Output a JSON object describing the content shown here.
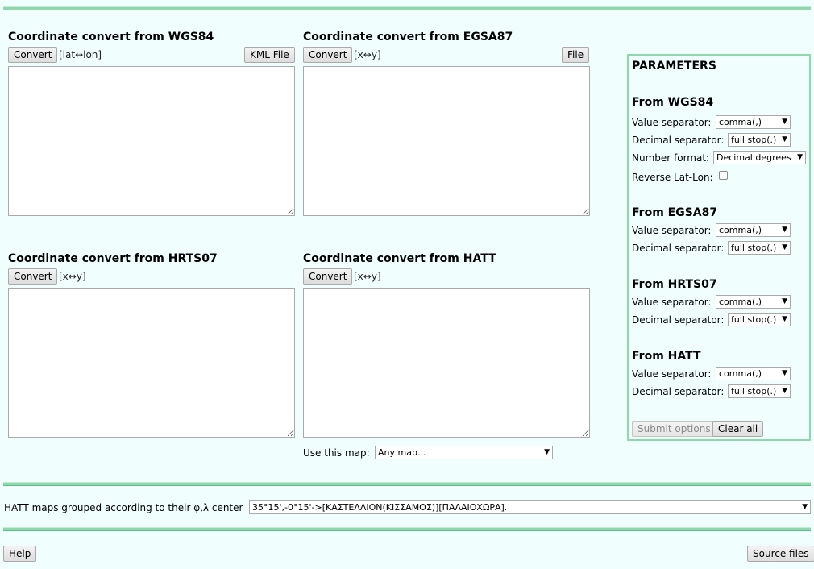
{
  "wgs84": {
    "title": "Coordinate convert from WGS84",
    "convert_label": "Convert",
    "hint": "[lat↔lon]",
    "file_label": "KML File"
  },
  "egsa87": {
    "title": "Coordinate convert from EGSA87",
    "convert_label": "Convert",
    "hint": "[x↔y]",
    "file_label": "File"
  },
  "hrts07": {
    "title": "Coordinate convert from HRTS07",
    "convert_label": "Convert",
    "hint": "[x↔y]"
  },
  "hatt": {
    "title": "Coordinate convert from HATT",
    "convert_label": "Convert",
    "hint": "[x↔y]"
  },
  "map": {
    "label": "Use this map:",
    "selected": "Any map..."
  },
  "params": {
    "title": "PARAMETERS",
    "from_wgs84": {
      "title": "From WGS84",
      "value_sep_label": "Value separator:",
      "value_sep": "comma(,)",
      "decimal_sep_label": "Decimal separator:",
      "decimal_sep": "full stop(.)",
      "number_format_label": "Number format:",
      "number_format": "Decimal degrees",
      "reverse_label": "Reverse Lat-Lon:"
    },
    "from_egsa87": {
      "title": "From EGSA87",
      "value_sep_label": "Value separator:",
      "value_sep": "comma(,)",
      "decimal_sep_label": "Decimal separator:",
      "decimal_sep": "full stop(.)"
    },
    "from_hrts07": {
      "title": "From HRTS07",
      "value_sep_label": "Value separator:",
      "value_sep": "comma(,)",
      "decimal_sep_label": "Decimal separator:",
      "decimal_sep": "full stop(.)"
    },
    "from_hatt": {
      "title": "From HATT",
      "value_sep_label": "Value separator:",
      "value_sep": "comma(,)",
      "decimal_sep_label": "Decimal separator:",
      "decimal_sep": "full stop(.)"
    },
    "submit_label": "Submit options",
    "clear_label": "Clear all"
  },
  "hatt_maps": {
    "label": "HATT maps grouped according to their φ,λ center",
    "selected": "35°15',-0°15'->[ΚΑΣΤΕΛΛΙΟΝ(ΚΙΣΣΑΜΟΣ)][ΠΑΛΑΙΟΧΩΡΑ]."
  },
  "footer": {
    "help_label": "Help",
    "source_label": "Source files"
  },
  "icons": {
    "dropdown_arrow": "▼"
  }
}
